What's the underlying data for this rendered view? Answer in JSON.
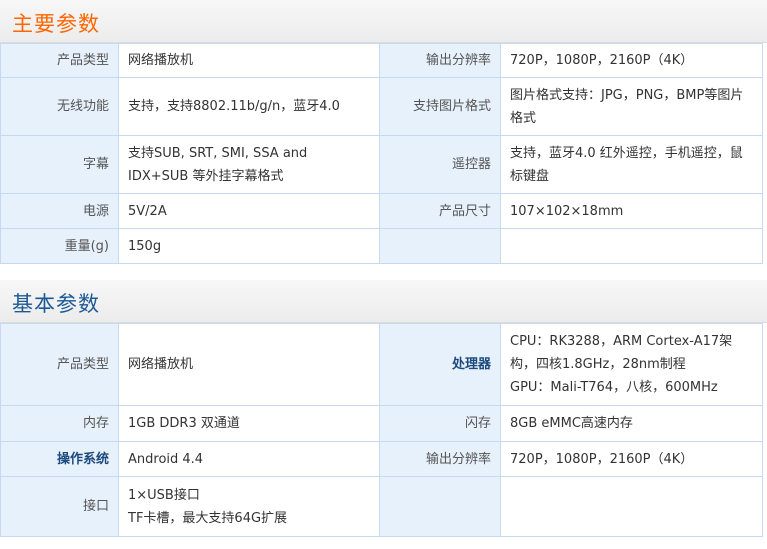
{
  "sections": [
    {
      "title": "主要参数",
      "rows": [
        {
          "l1": "产品类型",
          "v1": "网络播放机",
          "l2": "输出分辨率",
          "v2": "720P，1080P，2160P（4K）"
        },
        {
          "l1": "无线功能",
          "v1": "支持，支持8802.11b/g/n，蓝牙4.0",
          "l2": "支持图片格式",
          "v2": "图片格式支持：JPG，PNG，BMP等图片格式"
        },
        {
          "l1": "字幕",
          "v1": "支持SUB, SRT, SMI, SSA and IDX+SUB 等外挂字幕格式",
          "l2": "遥控器",
          "v2": "支持，蓝牙4.0 红外遥控，手机遥控，鼠标键盘"
        },
        {
          "l1": "电源",
          "v1": "5V/2A",
          "l2": "产品尺寸",
          "v2": "107×102×18mm"
        },
        {
          "l1": "重量(g)",
          "v1": "150g",
          "l2": "",
          "v2": ""
        }
      ]
    },
    {
      "title": "基本参数",
      "rows": [
        {
          "l1": "产品类型",
          "v1": "网络播放机",
          "l2": "处理器",
          "v2": "CPU：RK3288，ARM Cortex-A17架构，四核1.8GHz，28nm制程",
          "v2b": "GPU：Mali-T764，八核，600MHz"
        },
        {
          "l1": "内存",
          "v1": "1GB DDR3 双通道",
          "l2": "闪存",
          "v2": "8GB eMMC高速内存"
        },
        {
          "l1": "操作系统",
          "v1": "Android 4.4",
          "l2": "输出分辨率",
          "v2": "720P，1080P，2160P（4K）"
        },
        {
          "l1": "接口",
          "v1": "1×USB接口",
          "v1b": "TF卡槽，最大支持64G扩展",
          "l2": "",
          "v2": ""
        }
      ]
    }
  ]
}
